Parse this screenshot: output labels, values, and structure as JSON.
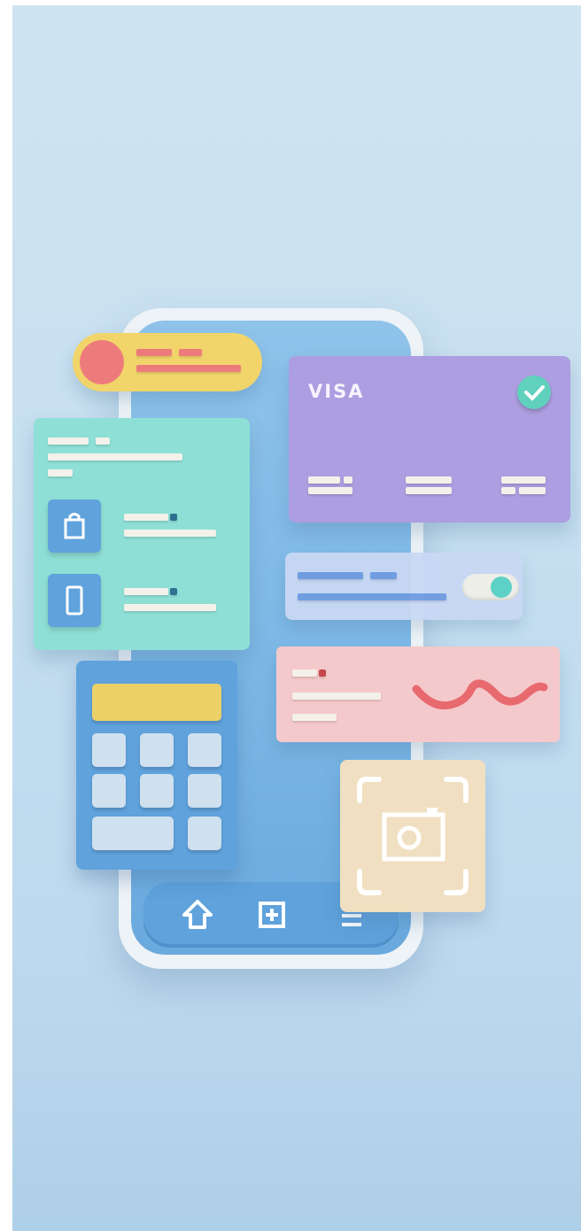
{
  "illustration": {
    "visa_card": {
      "brand_label": "VISA",
      "status_icon": "check-circle-icon"
    },
    "phone_nav": {
      "icons": [
        "home-icon",
        "add-box-icon",
        "menu-icon"
      ]
    },
    "teal_list": {
      "item_icons": [
        "shopping-bag-icon",
        "smartphone-icon"
      ]
    },
    "toggle": {
      "state": "on"
    },
    "camera_card": {
      "icon": "camera-scan-icon"
    }
  },
  "colors": {
    "background": "#c6dff0",
    "phone_screen": "#7ab6e5",
    "yellow": "#f1d56b",
    "coral": "#ee7b7b",
    "teal": "#8ee0d6",
    "purple": "#ac9ee0",
    "pink": "#f4c9cb",
    "blue": "#5fa2dc",
    "cream": "#f0dfc0"
  }
}
